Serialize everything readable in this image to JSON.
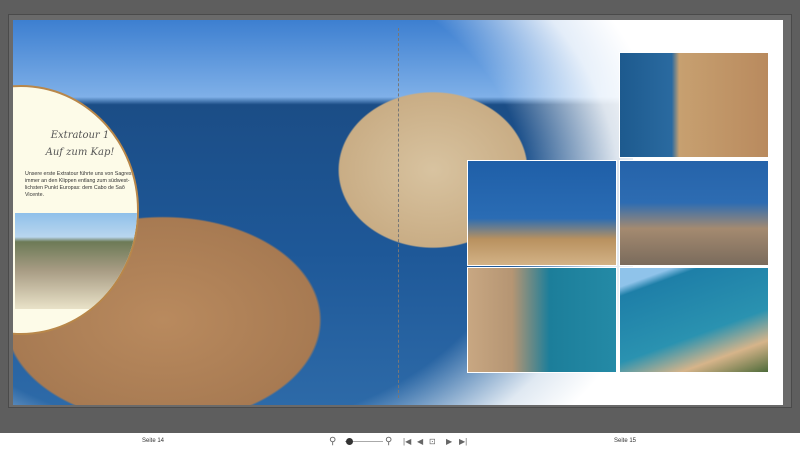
{
  "left_page": {
    "title_line1": "Extratour 1",
    "title_line2": "Auf zum Kap!",
    "body": "Unsere erste Extratour führte uns von Sagres aus immer an den Klippen entlang zum südwest-lichsten Punkt Europas: dem Cabo de Saõ Vicente.",
    "label": "Seite 14"
  },
  "right_page": {
    "label": "Seite 15"
  },
  "toolbar": {
    "zoom_percent": 10,
    "icons": [
      "zoom-out-icon",
      "zoom-in-icon",
      "first-page-icon",
      "previous-page-icon",
      "fit-page-icon",
      "next-page-icon",
      "last-page-icon"
    ]
  },
  "colors": {
    "background": "#5e5e5e",
    "oval_border": "#b8874a"
  }
}
